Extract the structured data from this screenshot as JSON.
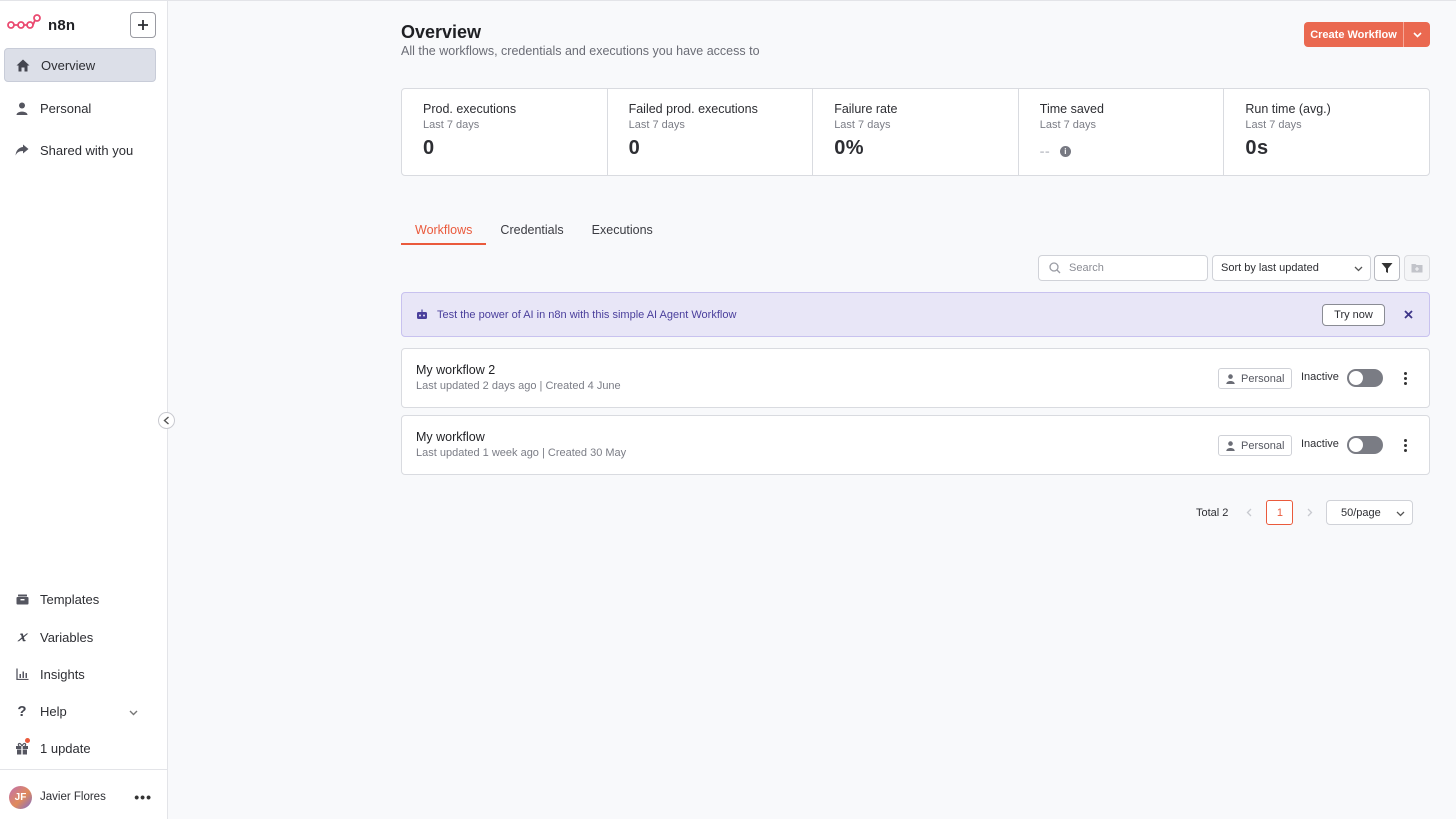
{
  "app": {
    "name": "n8n",
    "brand_color": "#ea4b71"
  },
  "sidebar": {
    "nav": [
      {
        "label": "Overview",
        "icon": "home-icon",
        "active": true
      },
      {
        "label": "Personal",
        "icon": "user-icon"
      },
      {
        "label": "Shared with you",
        "icon": "share-icon"
      }
    ],
    "bottom": [
      {
        "label": "Templates",
        "icon": "box-icon"
      },
      {
        "label": "Variables",
        "icon": "variable-icon"
      },
      {
        "label": "Insights",
        "icon": "chart-icon"
      },
      {
        "label": "Help",
        "icon": "question-icon"
      },
      {
        "label": "1 update",
        "icon": "gift-icon"
      }
    ],
    "user": {
      "initials": "JF",
      "name": "Javier Flores"
    }
  },
  "header": {
    "title": "Overview",
    "subtitle": "All the workflows, credentials and executions you have access to",
    "create_label": "Create Workflow"
  },
  "stats": [
    {
      "label": "Prod. executions",
      "period": "Last 7 days",
      "value": "0"
    },
    {
      "label": "Failed prod. executions",
      "period": "Last 7 days",
      "value": "0"
    },
    {
      "label": "Failure rate",
      "period": "Last 7 days",
      "value": "0%"
    },
    {
      "label": "Time saved",
      "period": "Last 7 days",
      "value": "--"
    },
    {
      "label": "Run time (avg.)",
      "period": "Last 7 days",
      "value": "0s"
    }
  ],
  "tabs": [
    "Workflows",
    "Credentials",
    "Executions"
  ],
  "toolbar": {
    "search_placeholder": "Search",
    "sort_label": "Sort by last updated"
  },
  "banner": {
    "text": "Test the power of AI in n8n with this simple AI Agent Workflow",
    "button": "Try now"
  },
  "workflows": [
    {
      "name": "My workflow 2",
      "meta": "Last updated 2 days ago | Created 4 June",
      "owner": "Personal",
      "status": "Inactive"
    },
    {
      "name": "My workflow",
      "meta": "Last updated 1 week ago | Created 30 May",
      "owner": "Personal",
      "status": "Inactive"
    }
  ],
  "pagination": {
    "total": "Total 2",
    "page": "1",
    "page_size": "50/page"
  },
  "colors": {
    "accent": "#ea6950",
    "active_tab": "#ea5a3c",
    "banner_bg": "#e8e6f7"
  }
}
